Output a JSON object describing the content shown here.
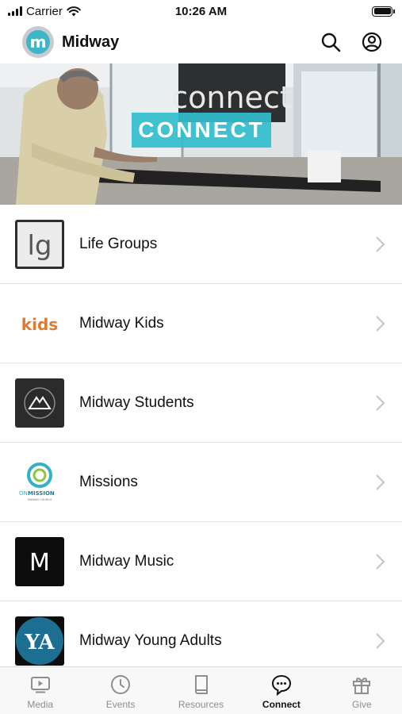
{
  "status_bar": {
    "carrier": "Carrier",
    "time": "10:26 AM"
  },
  "header": {
    "app_name": "Midway",
    "logo_letter": "m"
  },
  "hero": {
    "sign_text": "connect",
    "label": "CONNECT"
  },
  "list": [
    {
      "label": "Life Groups",
      "icon": "life-groups-logo",
      "thumb_text": "lg"
    },
    {
      "label": "Midway Kids",
      "icon": "kids-logo",
      "thumb_text": "kids"
    },
    {
      "label": "Midway Students",
      "icon": "students-logo"
    },
    {
      "label": "Missions",
      "icon": "on-mission-logo",
      "thumb_text_1": "ON",
      "thumb_text_2": "MISSION",
      "thumb_text_3": "MIDWAY CHURCH"
    },
    {
      "label": "Midway Music",
      "icon": "music-logo",
      "thumb_text": "M"
    },
    {
      "label": "Midway Young Adults",
      "icon": "young-adults-logo",
      "thumb_text": "YA"
    }
  ],
  "tabs": [
    {
      "label": "Media",
      "icon": "media-icon",
      "active": false
    },
    {
      "label": "Events",
      "icon": "clock-icon",
      "active": false
    },
    {
      "label": "Resources",
      "icon": "book-icon",
      "active": false
    },
    {
      "label": "Connect",
      "icon": "chat-bubble-icon",
      "active": true
    },
    {
      "label": "Give",
      "icon": "gift-icon",
      "active": false
    }
  ],
  "colors": {
    "accent": "#3fb6c8",
    "active_tab": "#111111",
    "inactive_tab": "#8e8e8e"
  }
}
